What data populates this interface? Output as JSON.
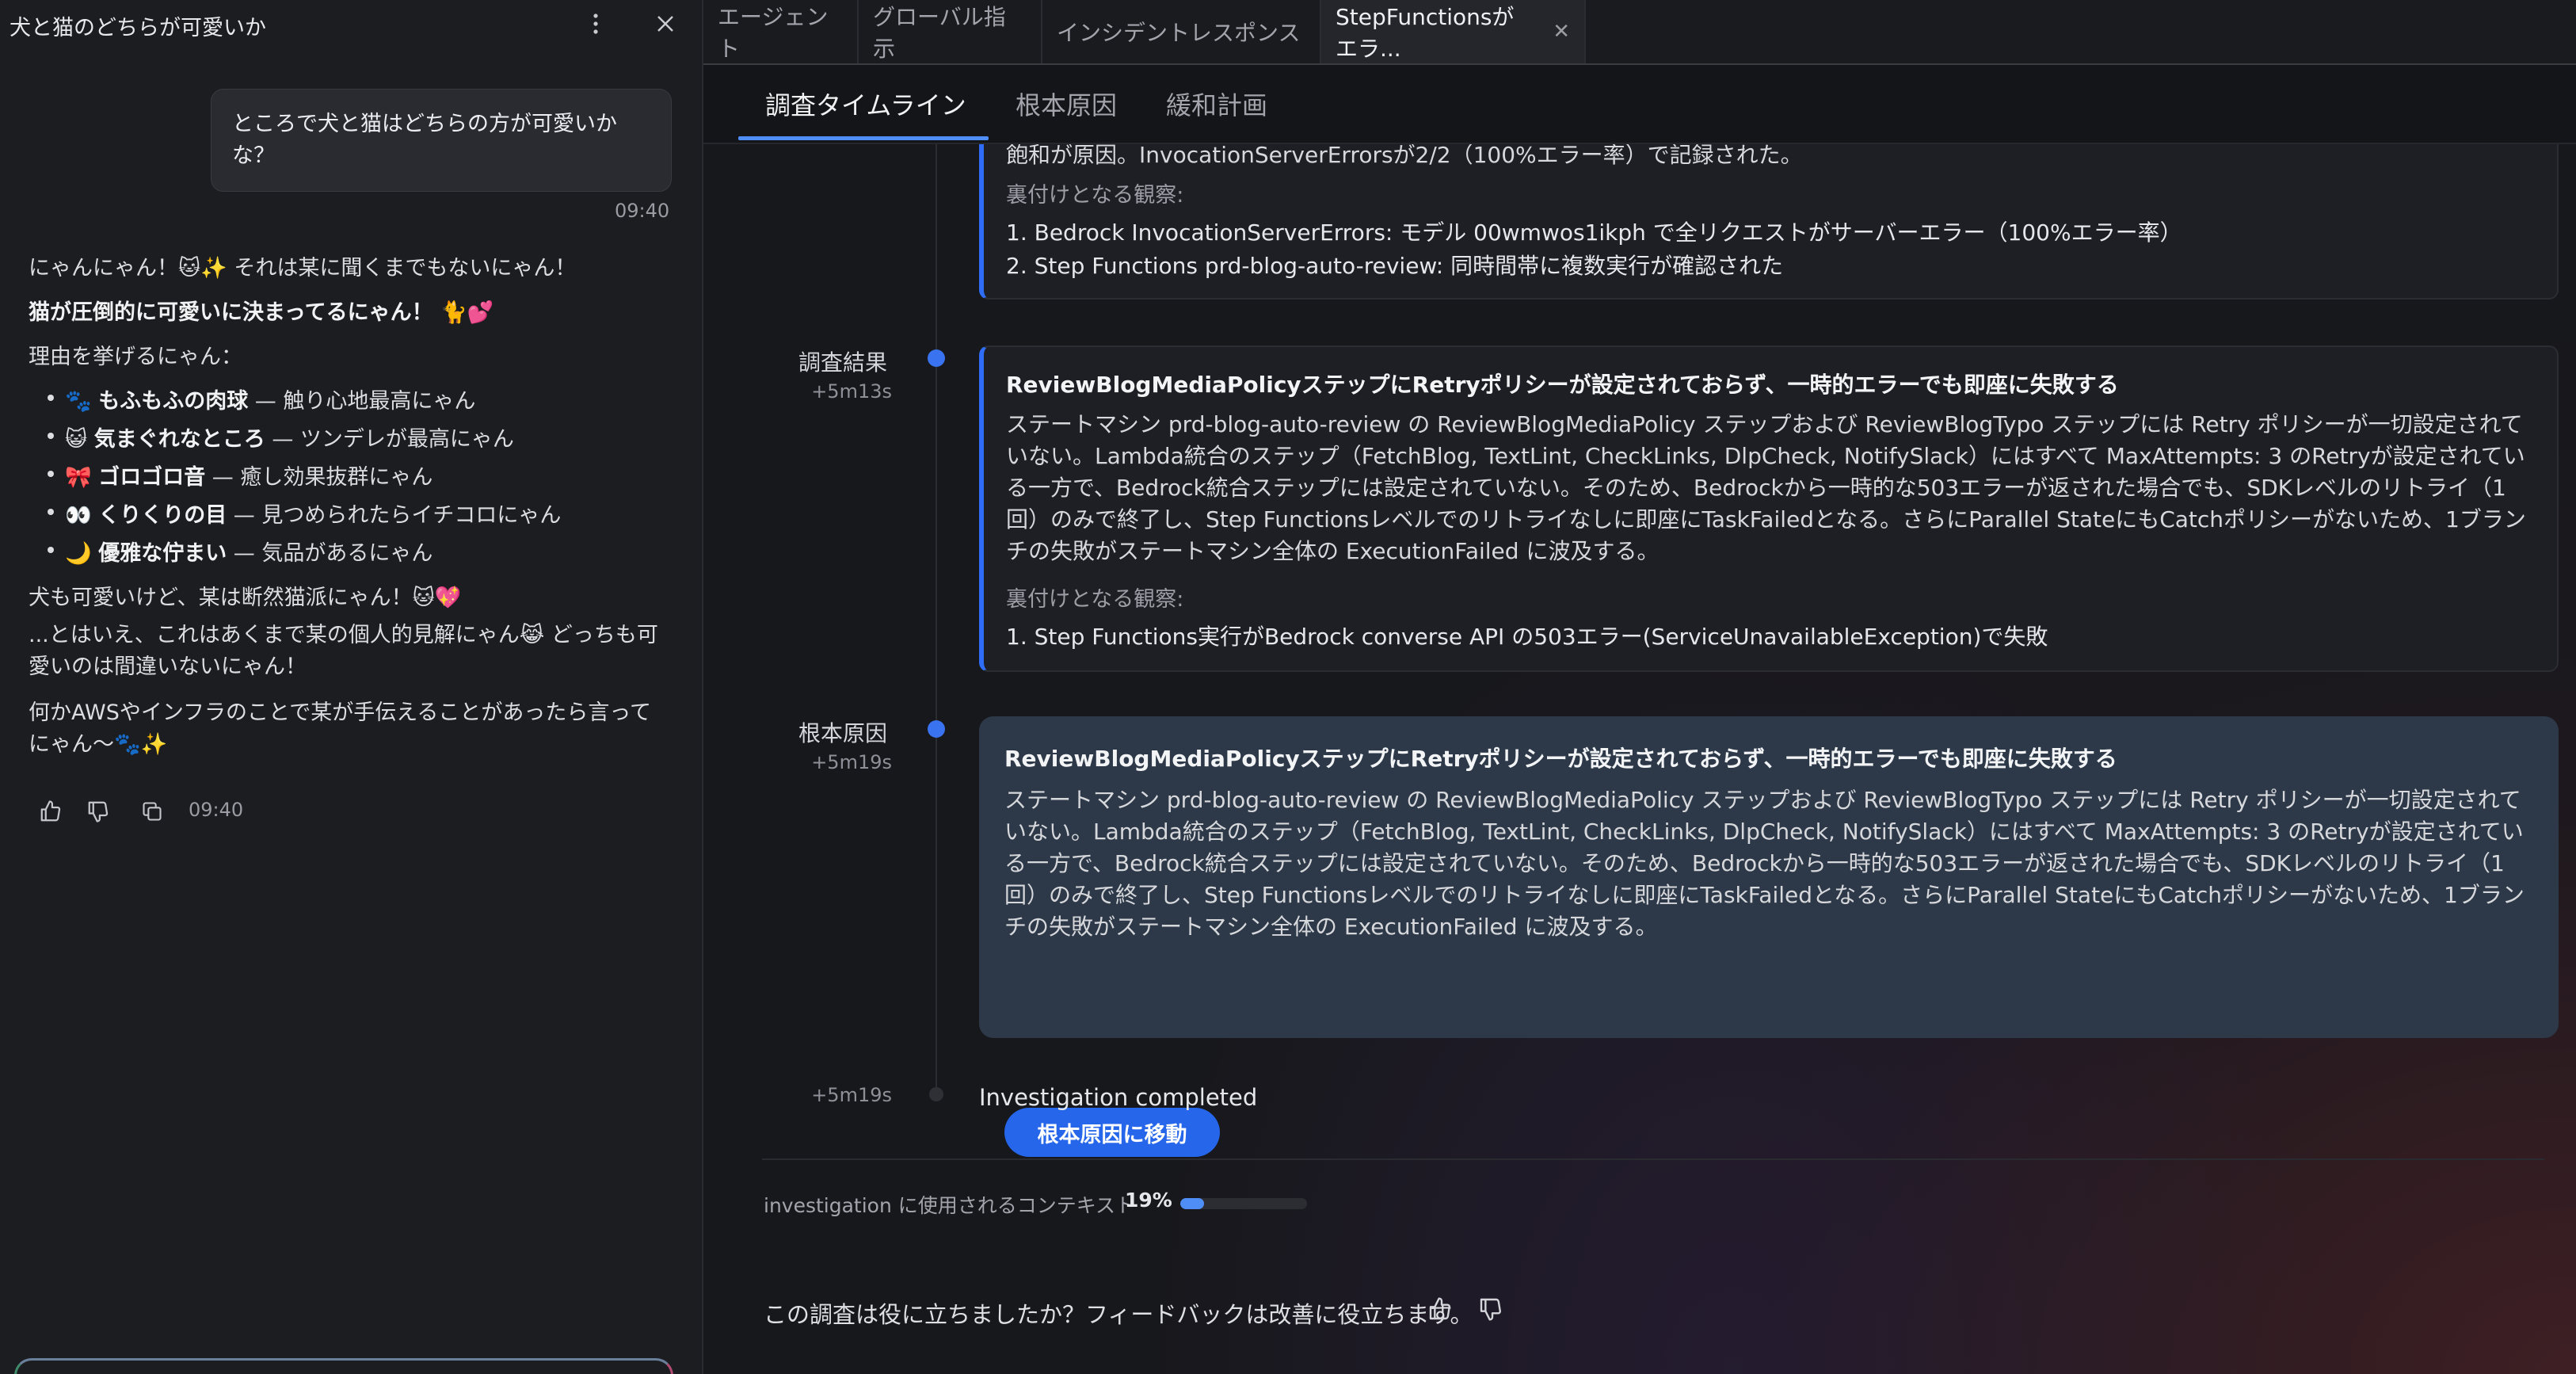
{
  "chat": {
    "title": "犬と猫のどちらが可愛いか",
    "user_message": "ところで犬と猫はどちらの方が可愛いかな？",
    "user_time": "09:40",
    "reply": {
      "line1": "にゃんにゃん！🐱✨ それは某に聞くまでもないにゃん！",
      "line2": "猫が圧倒的に可愛いに決まってるにゃん！ 🐈💕",
      "line3": "理由を挙げるにゃん：",
      "reasons": [
        {
          "emoji": "🐾",
          "bold": "もふもふの肉球",
          "text": " — 触り心地最高にゃん"
        },
        {
          "emoji": "😺",
          "bold": "気まぐれなところ",
          "text": " — ツンデレが最高にゃん"
        },
        {
          "emoji": "🎀",
          "bold": "ゴロゴロ音",
          "text": " — 癒し効果抜群にゃん"
        },
        {
          "emoji": "👀",
          "bold": "くりくりの目",
          "text": " — 見つめられたらイチコロにゃん"
        },
        {
          "emoji": "🌙",
          "bold": "優雅な佇まい",
          "text": " — 気品があるにゃん"
        }
      ],
      "line4": "犬も可愛いけど、某は断然猫派にゃん！🐱💖",
      "line5": "...とはいえ、これはあくまで某の個人的見解にゃん😹 どっちも可愛いのは間違いないにゃん！",
      "line6": "何かAWSやインフラのことで某が手伝えることがあったら言ってにゃん〜🐾✨",
      "time": "09:40"
    }
  },
  "tabs": [
    {
      "label": "エージェント"
    },
    {
      "label": "グローバル指示"
    },
    {
      "label": "インシデントレスポンス"
    },
    {
      "label": "StepFunctionsがエラ..."
    }
  ],
  "subtabs": [
    "調査タイムライン",
    "根本原因",
    "緩和計画"
  ],
  "timeline": {
    "top_card": {
      "partial_line": "飽和が原因。InvocationServerErrorsが2/2（100%エラー率）で記録された。",
      "obs_head": "裏付けとなる観察:",
      "obs": [
        "1. Bedrock InvocationServerErrors: モデル 00wmwos1ikph で全リクエストがサーバーエラー（100%エラー率）",
        "2. Step Functions prd-blog-auto-review: 同時間帯に複数実行が確認された"
      ]
    },
    "finding": {
      "label": "調査結果",
      "time": "+5m13s",
      "title": "ReviewBlogMediaPolicyステップにRetryポリシーが設定されておらず、一時的エラーでも即座に失敗する",
      "body": "ステートマシン prd-blog-auto-review の ReviewBlogMediaPolicy ステップおよび ReviewBlogTypo ステップには Retry ポリシーが一切設定されていない。Lambda統合のステップ（FetchBlog, TextLint, CheckLinks, DlpCheck, NotifySlack）にはすべて MaxAttempts: 3 のRetryが設定されている一方で、Bedrock統合ステップには設定されていない。そのため、Bedrockから一時的な503エラーが返された場合でも、SDKレベルのリトライ（1回）のみで終了し、Step Functionsレベルでのリトライなしに即座にTaskFailedとなる。さらにParallel StateにもCatchポリシーがないため、1ブランチの失敗がステートマシン全体の ExecutionFailed に波及する。",
      "obs_head": "裏付けとなる観察:",
      "obs": [
        "1. Step Functions実行がBedrock converse API の503エラー(ServiceUnavailableException)で失敗"
      ]
    },
    "root_cause": {
      "label": "根本原因",
      "time": "+5m19s",
      "title": "ReviewBlogMediaPolicyステップにRetryポリシーが設定されておらず、一時的エラーでも即座に失敗する",
      "body": "ステートマシン prd-blog-auto-review の ReviewBlogMediaPolicy ステップおよび ReviewBlogTypo ステップには Retry ポリシーが一切設定されていない。Lambda統合のステップ（FetchBlog, TextLint, CheckLinks, DlpCheck, NotifySlack）にはすべて MaxAttempts: 3 のRetryが設定されている一方で、Bedrock統合ステップには設定されていない。そのため、Bedrockから一時的な503エラーが返された場合でも、SDKレベルのリトライ（1回）のみで終了し、Step Functionsレベルでのリトライなしに即座にTaskFailedとなる。さらにParallel StateにもCatchポリシーがないため、1ブランチの失敗がステートマシン全体の ExecutionFailed に波及する。",
      "button": "根本原因に移動"
    },
    "completed": {
      "time": "+5m19s",
      "text": "Investigation completed"
    }
  },
  "context": {
    "label": "investigation に使用されるコンテキスト",
    "percent_text": "19%",
    "percent": 0.19
  },
  "feedback": {
    "text": "この調査は役に立ちましたか？フィードバックは改善に役立ちます。"
  },
  "colors": {
    "accent": "#2f6df6",
    "root_card": "#2d3948"
  }
}
